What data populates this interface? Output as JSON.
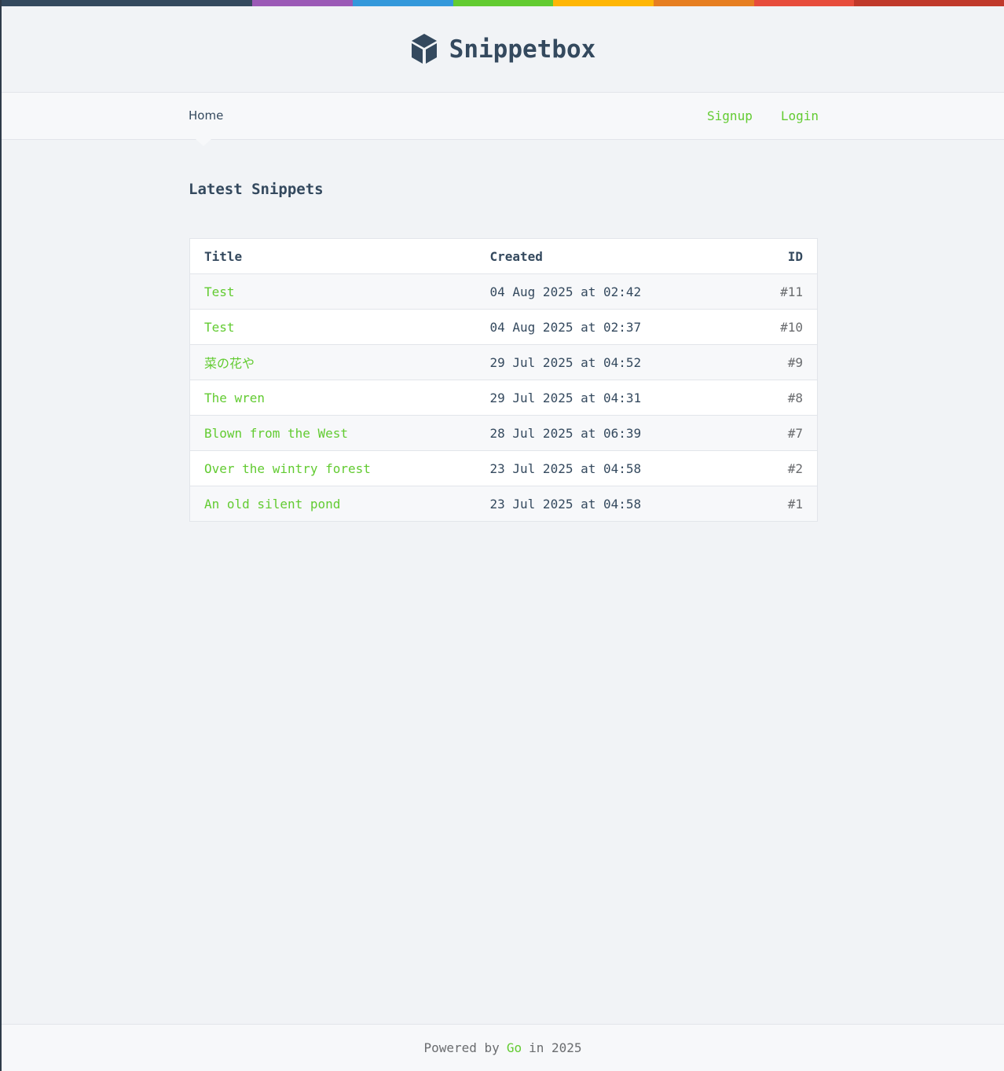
{
  "colors": {
    "accent": "#62cb31",
    "text": "#34495e",
    "muted": "#6a6c6f",
    "background": "#f1f3f6",
    "stripe": [
      "#34495e",
      "#9b59b6",
      "#3498db",
      "#62cb31",
      "#ffb606",
      "#e67e22",
      "#e74c3c",
      "#c0392b"
    ]
  },
  "header": {
    "logo_icon": "cube-icon",
    "brand": "Snippetbox"
  },
  "nav": {
    "home": "Home",
    "signup": "Signup",
    "login": "Login"
  },
  "main": {
    "title": "Latest Snippets",
    "columns": {
      "title": "Title",
      "created": "Created",
      "id": "ID"
    },
    "rows": [
      {
        "title": "Test",
        "created": "04 Aug 2025 at 02:42",
        "id": "#11"
      },
      {
        "title": "Test",
        "created": "04 Aug 2025 at 02:37",
        "id": "#10"
      },
      {
        "title": "菜の花や",
        "created": "29 Jul 2025 at 04:52",
        "id": "#9"
      },
      {
        "title": "The wren",
        "created": "29 Jul 2025 at 04:31",
        "id": "#8"
      },
      {
        "title": "Blown from the West",
        "created": "28 Jul 2025 at 06:39",
        "id": "#7"
      },
      {
        "title": "Over the wintry forest",
        "created": "23 Jul 2025 at 04:58",
        "id": "#2"
      },
      {
        "title": "An old silent pond",
        "created": "23 Jul 2025 at 04:58",
        "id": "#1"
      }
    ]
  },
  "footer": {
    "prefix": "Powered by",
    "link": "Go",
    "suffix": "in 2025"
  }
}
